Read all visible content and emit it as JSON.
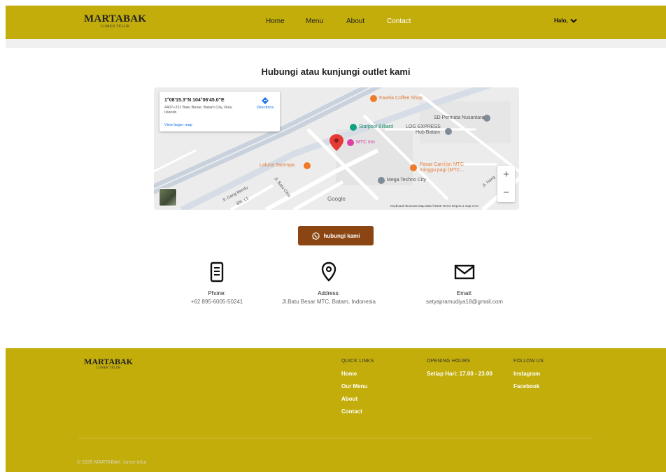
{
  "header": {
    "brand": "MARTABAK",
    "brand_sub": "LUMER TELUR",
    "nav": [
      "Home",
      "Menu",
      "About",
      "Contact"
    ],
    "active": "Contact",
    "user_label": "Halo,"
  },
  "page_title": "Hubungi atau kunjungi outlet kami",
  "map": {
    "coords": "1°08'15.3\"N 104°06'45.0\"E",
    "address": "4407+22J Batu Besar, Batam City, Riau Islands",
    "directions": "Directions",
    "larger_map": "View larger map",
    "places": {
      "favela": "Favela Coffee Shop",
      "sd": "SD Permata Nusantara",
      "starpool": "Starpool Billiard",
      "log1": "LOG EXPRESS",
      "log2": "Hub Batam",
      "mtc": "MTC Inn",
      "laluna": "Laluna Tarempa",
      "pasar1": "Pasar Camilan MTC",
      "pasar2": "minggu pagi (MTC...",
      "mega": "Mega Techno City",
      "road1": "Jl. Dang Merdu",
      "road2": "Blk. L1",
      "road3": "Jl. Batu Citra",
      "road4": "Jl. Hang"
    },
    "google": "Google",
    "attribution": "Keyboard shortcuts   Map data ©2025   Terms   Report a map error",
    "zoom_in": "+",
    "zoom_out": "−"
  },
  "cta": "hubungi kami",
  "contact": {
    "phone_label": "Phone:",
    "phone": "+62 895-6005-50241",
    "address_label": "Address:",
    "address": "Jl.Batu Besar MTC, Batam, Indonesia",
    "email_label": "Email:",
    "email": "setyapramudiya18@gmail.com"
  },
  "footer": {
    "brand": "MARTABAK",
    "brand_sub": "LUMER TELUR",
    "quick_title": "QUICK LINKS",
    "quick": [
      "Home",
      "Our Menu",
      "About",
      "Contact"
    ],
    "hours_title": "OPENING HOURS",
    "hours": "Setiap Hari: 17.00 - 23.00",
    "follow_title": "FOLLOW US",
    "social": [
      "Instagram",
      "Facebook"
    ],
    "copyright": "© 2025 MARTABAK. lumer telur"
  },
  "colors": {
    "primary": "#c2ad0a",
    "button": "#8b4513"
  }
}
